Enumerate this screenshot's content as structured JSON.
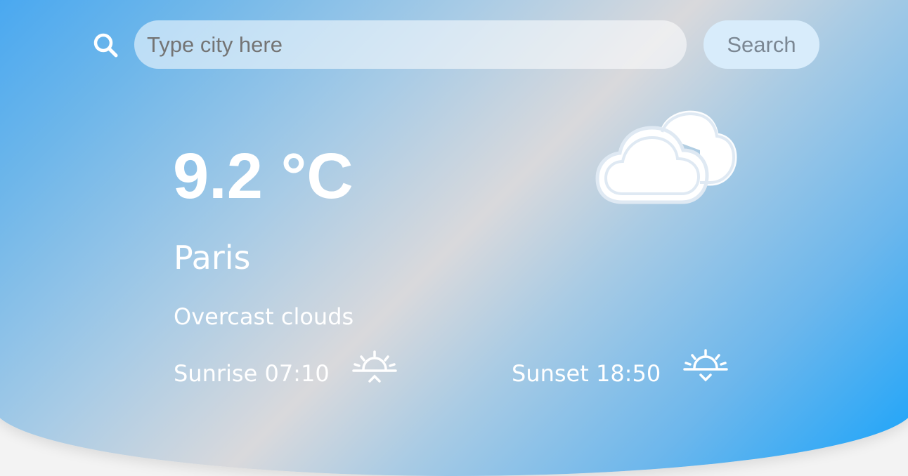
{
  "search": {
    "placeholder": "Type city here",
    "button_label": "Search",
    "icon": "search-icon"
  },
  "weather": {
    "temperature": "9.2 °C",
    "city": "Paris",
    "description": "Overcast clouds",
    "condition_icon": "cloud-icon",
    "sunrise_label": "Sunrise 07:10",
    "sunrise_icon": "sunrise-icon",
    "sunset_label": "Sunset 18:50",
    "sunset_icon": "sunset-icon"
  },
  "colors": {
    "gradient_edge": "#14a2fb",
    "gradient_center": "#d9d9dc",
    "button_bg": "#d8ecfb",
    "text": "#ffffff"
  }
}
